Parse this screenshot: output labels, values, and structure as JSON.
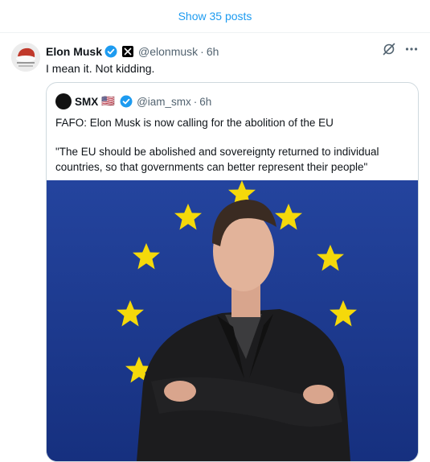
{
  "show_posts_label": "Show 35 posts",
  "post": {
    "author_name": "Elon Musk",
    "author_handle": "@elonmusk",
    "separator": "·",
    "time": "6h",
    "text": "I mean it. Not kidding.",
    "quoted": {
      "author_name": "SMX",
      "flag": "🇺🇸",
      "author_handle": "@iam_smx",
      "separator": "·",
      "time": "6h",
      "line1": "FAFO: Elon Musk is now calling for the abolition of the EU",
      "line2": "\"The EU should be abolished and sovereignty returned to individual countries, so that governments can better represent their people\""
    }
  },
  "icons": {
    "verified": "verified-badge-icon",
    "x_logo": "x-logo-icon",
    "grok": "grok-icon",
    "more": "more-icon"
  },
  "colors": {
    "accent": "#1d9bf0",
    "eu_blue": "#1d3fa8",
    "eu_star": "#f5d90a"
  }
}
